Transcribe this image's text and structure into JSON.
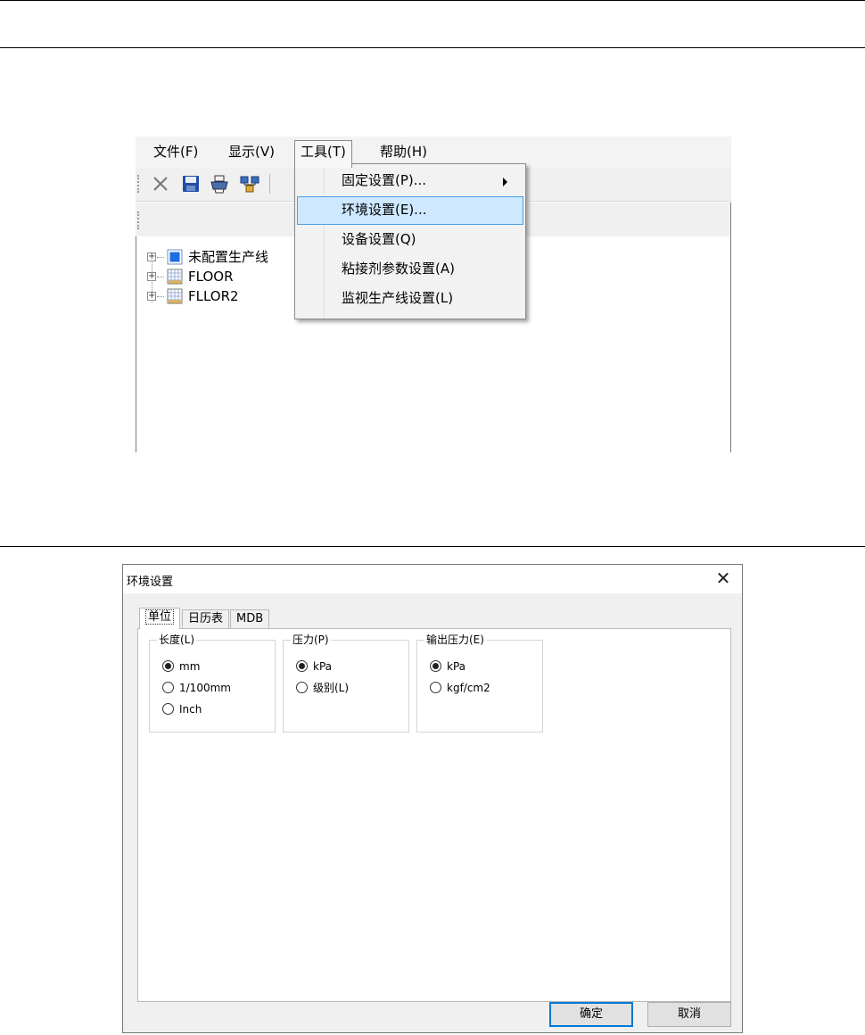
{
  "app": {
    "menus": [
      {
        "label": "文件(F)"
      },
      {
        "label": "显示(V)"
      },
      {
        "label": "工具(T)"
      },
      {
        "label": "帮助(H)"
      }
    ],
    "toolbar_icons": [
      "close-icon",
      "save-icon",
      "print-icon",
      "network-icon"
    ],
    "tree": [
      {
        "label": "未配置生产线",
        "icon": "blue-square-icon"
      },
      {
        "label": "FLOOR",
        "icon": "grid-icon"
      },
      {
        "label": "FLLOR2",
        "icon": "grid-icon"
      }
    ],
    "tools_menu": [
      {
        "label": "固定设置(P)...",
        "has_submenu": true
      },
      {
        "label": "环境设置(E)...",
        "highlighted": true
      },
      {
        "label": "设备设置(Q)"
      },
      {
        "label": "粘接剂参数设置(A)"
      },
      {
        "label": "监视生产线设置(L)"
      }
    ]
  },
  "dialog": {
    "title": "环境设置",
    "tabs": [
      {
        "label": "单位",
        "active": true
      },
      {
        "label": "日历表"
      },
      {
        "label": "MDB"
      }
    ],
    "groups": [
      {
        "legend": "长度(L)",
        "options": [
          {
            "label": "mm",
            "checked": true
          },
          {
            "label": "1/100mm",
            "checked": false
          },
          {
            "label": "Inch",
            "checked": false
          }
        ]
      },
      {
        "legend": "压力(P)",
        "options": [
          {
            "label": "kPa",
            "checked": true
          },
          {
            "label": "级别(L)",
            "checked": false
          }
        ]
      },
      {
        "legend": "输出压力(E)",
        "options": [
          {
            "label": "kPa",
            "checked": true
          },
          {
            "label": "kgf/cm2",
            "checked": false
          }
        ]
      }
    ],
    "ok_label": "确定",
    "cancel_label": "取消"
  },
  "colors": {
    "menu_highlight": "#cde8ff",
    "menu_highlight_border": "#4d9fe0",
    "default_button_border": "#0078d7"
  }
}
